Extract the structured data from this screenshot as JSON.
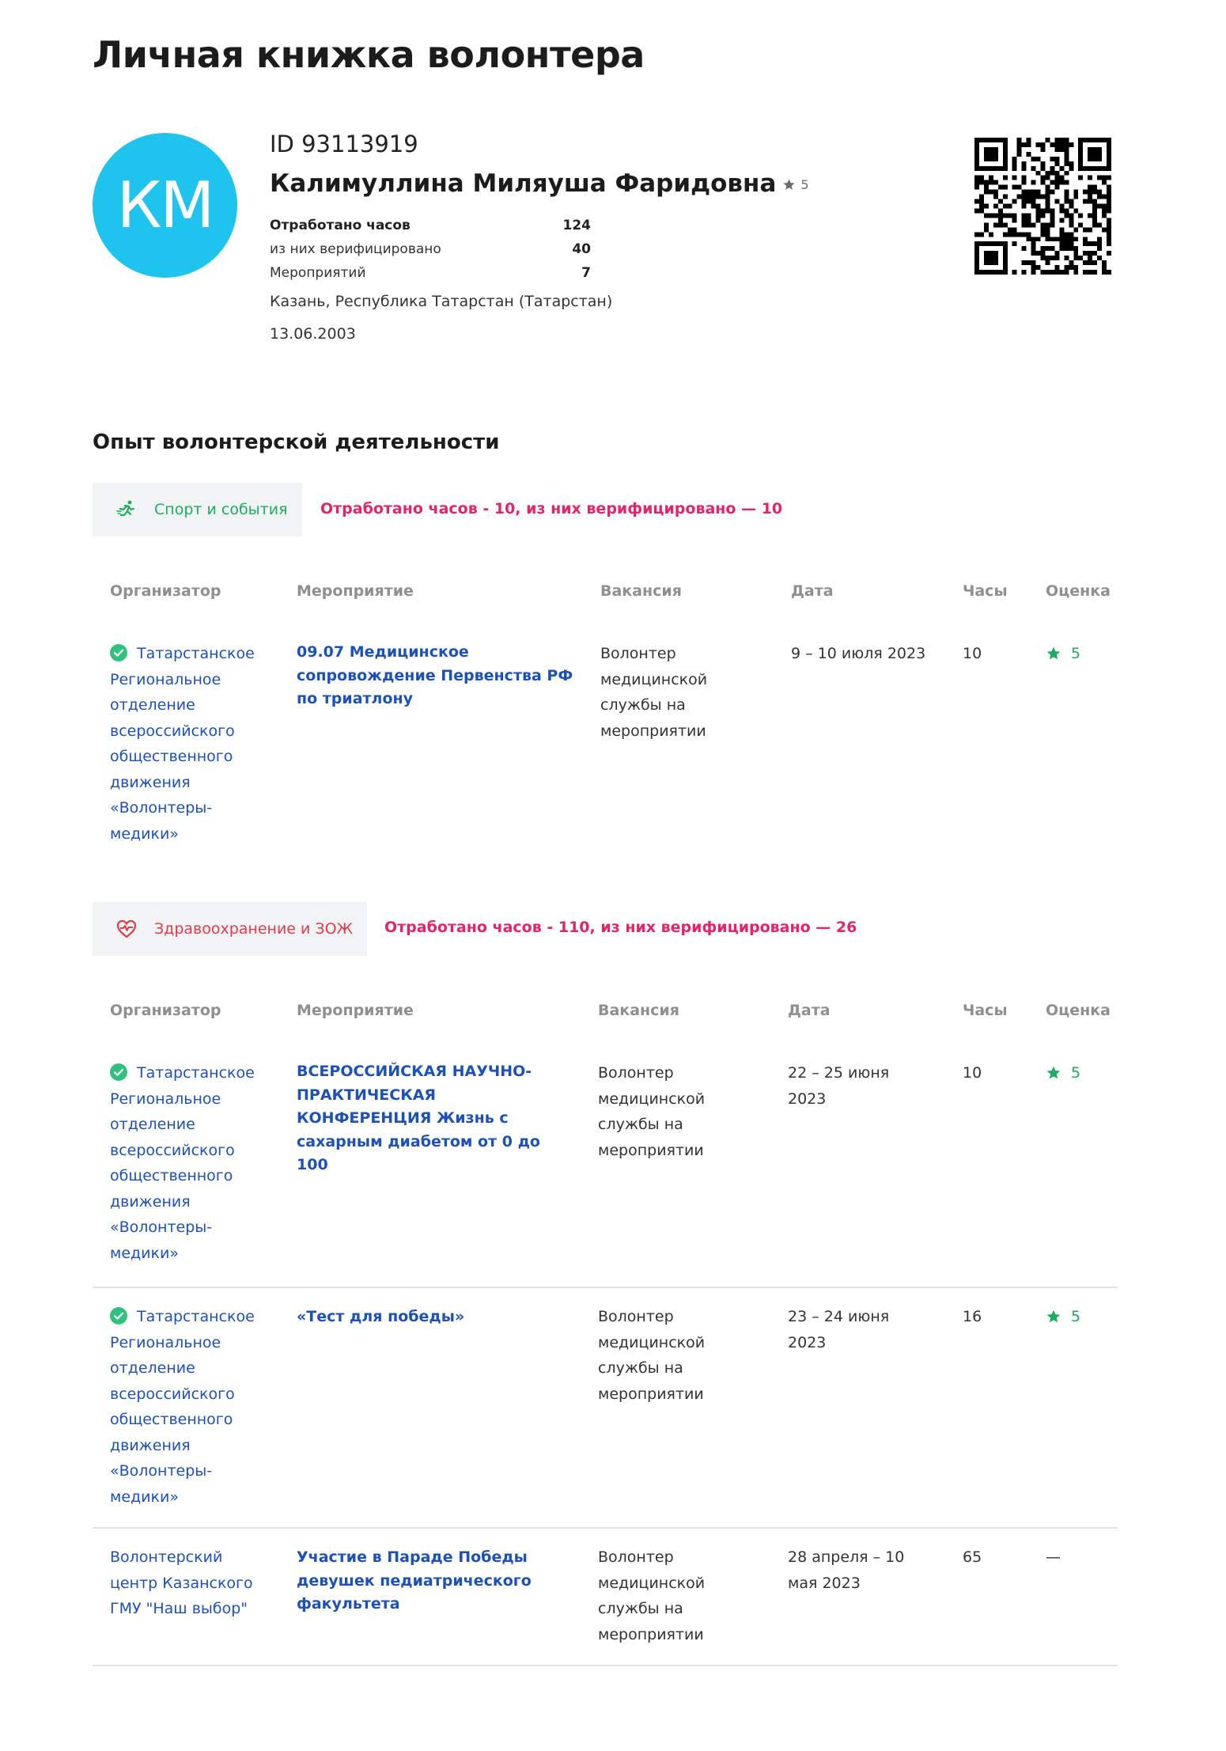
{
  "page_title": "Личная книжка волонтера",
  "profile": {
    "initials": "КМ",
    "avatar_color": "#1ec3ee",
    "id_text": "ID 93113919",
    "full_name": "Калимуллина Миляуша Фаридовна",
    "rating": "5",
    "stats": [
      {
        "label": "Отработано часов",
        "value": "124"
      },
      {
        "label": "из них верифицировано",
        "value": "40"
      },
      {
        "label": "Мероприятий",
        "value": "7"
      }
    ],
    "city": "Казань, Республика Татарстан (Татарстан)",
    "birth_date": "13.06.2003"
  },
  "experience": {
    "section_title": "Опыт волонтерской деятельности",
    "headers": {
      "organizer": "Организатор",
      "event": "Мероприятие",
      "vacancy": "Вакансия",
      "date": "Дата",
      "hours": "Часы",
      "grade": "Оценка"
    },
    "categories": [
      {
        "name": "Спорт и события",
        "icon": "running-person-icon",
        "color": "#1aae5e",
        "summary": "Отработано часов - 10, из них верифицировано — 10",
        "rows": [
          {
            "verified": true,
            "organizer": "Татарстанское Региональное отделение всероссийского общественного движения «Волонтеры-медики»",
            "event": "09.07 Медицинское сопровождение Первенства РФ по триатлону",
            "vacancy": "Волонтер медицинской службы на мероприятии",
            "date": "9 – 10 июля 2023",
            "hours": "10",
            "grade": "5"
          }
        ]
      },
      {
        "name": "Здравоохранение и ЗОЖ",
        "icon": "heart-pulse-icon",
        "color": "#e03a4e",
        "summary": "Отработано часов - 110, из них верифицировано — 26",
        "rows": [
          {
            "verified": true,
            "organizer": "Татарстанское Региональное отделение всероссийского общественного движения «Волонтеры-медики»",
            "event": "ВСЕРОССИЙСКАЯ НАУЧНО-ПРАКТИЧЕСКАЯ КОНФЕРЕНЦИЯ Жизнь с сахарным диабетом от 0 до 100",
            "vacancy": "Волонтер медицинской службы на мероприятии",
            "date": "22 – 25 июня 2023",
            "hours": "10",
            "grade": "5"
          },
          {
            "verified": true,
            "organizer": "Татарстанское Региональное отделение всероссийского общественного движения «Волонтеры-медики»",
            "event": "«Тест для победы»",
            "vacancy": "Волонтер медицинской службы на мероприятии",
            "date": "23 – 24 июня 2023",
            "hours": "16",
            "grade": "5"
          },
          {
            "verified": false,
            "organizer": "Волонтерский центр Казанского ГМУ \"Наш выбор\"",
            "event": "Участие в Параде Победы девушек педиатрического факультета",
            "vacancy": "Волонтер медицинской службы на мероприятии",
            "date": "28 апреля – 10 мая 2023",
            "hours": "65",
            "grade": "—"
          }
        ]
      }
    ]
  }
}
